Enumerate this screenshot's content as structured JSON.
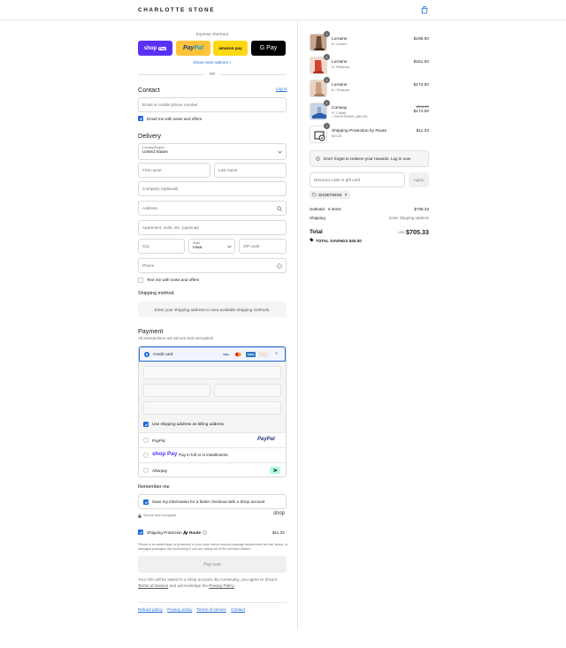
{
  "header": {
    "brand": "CHARLOTTE STONE",
    "cart_icon": "shopping-bag-icon"
  },
  "express": {
    "label": "Express checkout",
    "buttons": {
      "shoppay": "shop",
      "shoppay_tag": "Pay",
      "paypal_a": "Pay",
      "paypal_b": "Pal",
      "amazon": "amazon pay",
      "gpay": "G Pay"
    },
    "more_options": "Show more options »",
    "or": "OR"
  },
  "contact": {
    "title": "Contact",
    "login_link": "Log in",
    "phone_placeholder": "Email or mobile phone number",
    "email_news_label": "Email me with news and offers",
    "email_news_checked": true
  },
  "delivery": {
    "title": "Delivery",
    "country_label": "Country/Region",
    "country_value": "United States",
    "first_name": "First name",
    "last_name": "Last name",
    "company": "Company (optional)",
    "address": "Address",
    "apartment": "Apartment, suite, etc. (optional)",
    "city": "City",
    "state_label": "State",
    "state_value": "Iowa",
    "zip": "ZIP code",
    "phone": "Phone",
    "text_news_label": "Text me with news and offers",
    "text_news_checked": false
  },
  "shipping_method": {
    "title": "Shipping method",
    "notice": "Enter your shipping address to view available shipping methods."
  },
  "payment": {
    "title": "Payment",
    "subtitle": "All transactions are secure and encrypted.",
    "credit_card_label": "Credit card",
    "card_brands": [
      "VISA",
      "MC",
      "AMEX",
      "DISC"
    ],
    "more_cards": "+",
    "billing_same_label": "Use shipping address as billing address",
    "methods": [
      {
        "label": "PayPal",
        "logo": "PayPal"
      },
      {
        "label": "Pay in full or in installments",
        "logo": "shop Pay"
      },
      {
        "label": "Afterpay",
        "logo": "afterpay-icon"
      }
    ]
  },
  "remember": {
    "title": "Remember me",
    "save_label": "Save my information for a faster checkout with a Shop account",
    "secure_text": "Secure and encrypted",
    "shop_logo": "shop"
  },
  "route": {
    "label": "Shipping Protection",
    "brand": "Route",
    "price": "$11.33",
    "fine_print": "*Route is an added layer of protection to your order which ensures package replacement for lost, stolen, or damaged packages. By unchecking it, you are opting out of the premium feature."
  },
  "pay_now": "Pay now",
  "legal": {
    "line1": "Your info will be saved to a Shop account. By continuing, you agree to Shop's",
    "terms": "Terms of Service",
    "and": "and acknowledge the",
    "privacy": "Privacy Policy"
  },
  "footer_links": [
    "Refund policy",
    "Privacy policy",
    "Terms of service",
    "Contact"
  ],
  "summary": {
    "items": [
      {
        "qty": "1",
        "name": "Lorraine",
        "variant": "6 / Cosmo",
        "price": "$196.00",
        "thumb_color": "#c9a58c",
        "accent": "#6b4a3a"
      },
      {
        "qty": "1",
        "name": "Lorraine",
        "variant": "5 / Rebecca",
        "price": "$181.00",
        "thumb_color": "#f2d8cf",
        "accent": "#d3412f"
      },
      {
        "qty": "1",
        "name": "Lorraine",
        "variant": "6 / Treasure",
        "price": "$173.00",
        "thumb_color": "#e9d3c2",
        "accent": "#a77f63"
      },
      {
        "qty": "1",
        "name": "Conway",
        "variant": "5 / Cobalt",
        "discount": "SHOETWINS (-$40.00)",
        "original": "$214.00",
        "price": "$174.00",
        "thumb_color": "#c7d4e6",
        "accent": "#2b5fae"
      },
      {
        "qty": "1",
        "name": "Shipping Protection by Route",
        "variant": "$11.33",
        "price": "$11.33",
        "thumb_color": "#ffffff",
        "accent": "#1a1a1a"
      }
    ],
    "rewards_notice": "Don't forget to redeem your rewards. Log in now",
    "discount_placeholder": "Discount code or gift card",
    "apply": "Apply",
    "applied_code": "SHOETWINS",
    "subtotal_label": "Subtotal · 5 items",
    "subtotal_value": "$735.33",
    "shipping_label": "Shipping",
    "shipping_value": "Enter shipping address",
    "total_label": "Total",
    "currency": "USD",
    "total_value": "$705.33",
    "savings_label": "TOTAL SAVINGS",
    "savings_value": "$40.00"
  },
  "colors": {
    "accent": "#1f6bd8",
    "shoppay": "#5a31f4",
    "paypal": "#ffc439",
    "amazon": "#ffd814"
  }
}
